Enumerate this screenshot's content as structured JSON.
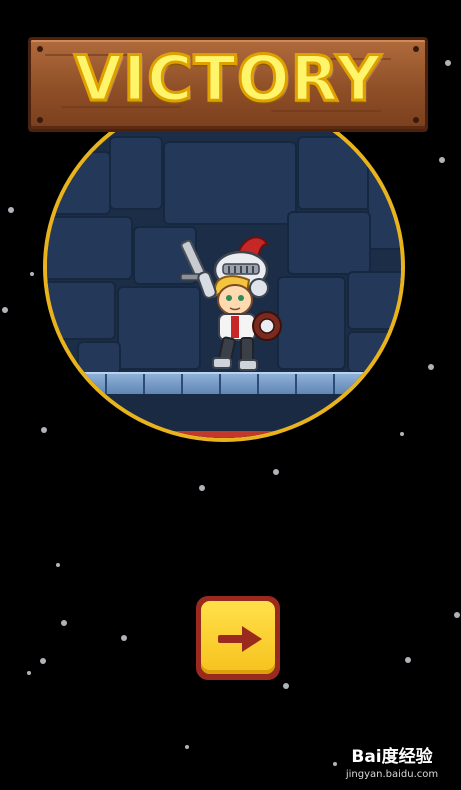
{
  "banner": {
    "title": "VICTORY"
  },
  "next_button": {
    "icon": "right-arrow-icon",
    "color": "#f6c21d",
    "arrow_color": "#9b2a1e"
  },
  "scene": {
    "character": "knight-character",
    "border_color": "#e8b31d"
  },
  "watermark": {
    "brand": "Bai度经验",
    "url": "jingyan.baidu.com"
  },
  "colors": {
    "background": "#000000",
    "banner_text": "#fff56a",
    "banner_wood": "#8f4f27"
  }
}
